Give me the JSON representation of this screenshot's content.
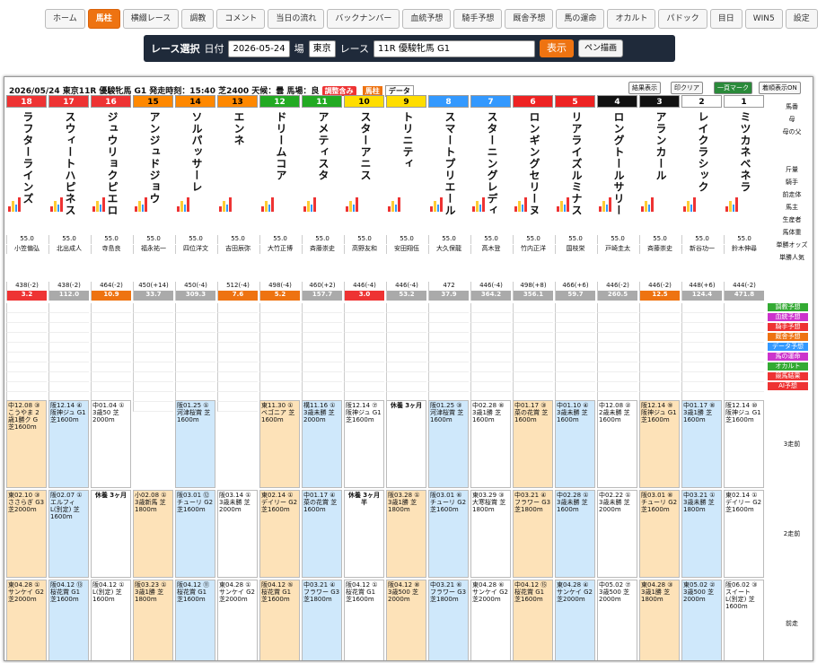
{
  "nav": [
    "ホーム",
    "馬柱",
    "横綴レース",
    "調教",
    "コメント",
    "当日の流れ",
    "バックナンバー",
    "血統予想",
    "騎手予想",
    "厩舎予想",
    "馬の運命",
    "オカルト",
    "パドック",
    "目日",
    "WIN5",
    "設定"
  ],
  "selector": {
    "title": "レース選択",
    "date_label": "日付",
    "date": "2026-05-24",
    "place_label": "場",
    "place": "東京",
    "race_label": "レース",
    "race": "11R 優駿牝馬 G1",
    "show": "表示",
    "pen": "ペン描画"
  },
  "raceinfo": "2026/05/24 東京11R 優駿牝馬 G1 発走時刻：15:40 芝2400 天候：曇 馬場：良",
  "tags": {
    "t1": "調整含み",
    "t2": "馬柱",
    "t3": "データ"
  },
  "header_buttons": [
    "結果表示",
    "印クリア",
    "一頁マーク",
    "着順表示ON"
  ],
  "row_labels": [
    "馬番",
    "母",
    "母の父",
    "",
    "",
    "斤量",
    "騎手",
    "前走体",
    "馬主",
    "生産者",
    "馬体重",
    "単勝オッズ",
    "単勝人気",
    "調教予想",
    "血統予想",
    "騎手予想",
    "厩舎予想",
    "データ予想",
    "馬の運命",
    "オカルト",
    "競馬結果",
    "AI予想",
    "3走前",
    "2走前",
    "前走"
  ],
  "horses": [
    {
      "num": "18",
      "name": "ラフターラインズ",
      "weight": "55.0",
      "jockey": "小笠偏弘",
      "trainer": "438(-2)",
      "odds": "3.2",
      "pop": "1"
    },
    {
      "num": "17",
      "name": "スウィートハピネス",
      "weight": "55.0",
      "jockey": "北出成人",
      "trainer": "438(-2)",
      "odds": "112.0",
      "pop": "14"
    },
    {
      "num": "16",
      "name": "ジュウリョクピエロ",
      "weight": "55.0",
      "jockey": "寺島良",
      "trainer": "464(-2)",
      "odds": "10.9",
      "pop": "6"
    },
    {
      "num": "15",
      "name": "アンジュドジョウ",
      "weight": "55.0",
      "jockey": "福永祐一",
      "trainer": "450(+14)",
      "odds": "33.7",
      "pop": "11"
    },
    {
      "num": "14",
      "name": "ソルパッサーレ",
      "weight": "55.0",
      "jockey": "四位洋文",
      "trainer": "450(-4)",
      "odds": "309.3",
      "pop": "18"
    },
    {
      "num": "13",
      "name": "エンネ",
      "weight": "55.0",
      "jockey": "吉田辰弥",
      "trainer": "512(-4)",
      "odds": "7.6",
      "pop": "4"
    },
    {
      "num": "12",
      "name": "ドリームコア",
      "weight": "55.0",
      "jockey": "大竹正博",
      "trainer": "498(-4)",
      "odds": "5.2",
      "pop": "3"
    },
    {
      "num": "11",
      "name": "アメティスタ",
      "weight": "55.0",
      "jockey": "斉藤崇史",
      "trainer": "460(+2)",
      "odds": "157.7",
      "pop": "16"
    },
    {
      "num": "10",
      "name": "スターアニス",
      "weight": "55.0",
      "jockey": "高野友和",
      "trainer": "446(-4)",
      "odds": "3.0",
      "pop": "2"
    },
    {
      "num": "9",
      "name": "トリニティ",
      "weight": "55.0",
      "jockey": "安田翔伍",
      "trainer": "446(-4)",
      "odds": "53.2",
      "pop": "13"
    },
    {
      "num": "8",
      "name": "スマートプリエール",
      "weight": "55.0",
      "jockey": "大久保龍",
      "trainer": "472",
      "odds": "37.9",
      "pop": "12"
    },
    {
      "num": "7",
      "name": "スターニングレディ",
      "weight": "55.0",
      "jockey": "高木登",
      "trainer": "446(-4)",
      "odds": "364.2",
      "pop": "17"
    },
    {
      "num": "6",
      "name": "ロンギングセリーヌ",
      "weight": "55.0",
      "jockey": "竹内正洋",
      "trainer": "498(+8)",
      "odds": "356.1",
      "pop": "15"
    },
    {
      "num": "5",
      "name": "リアライズルミナス",
      "weight": "55.0",
      "jockey": "国枝栄",
      "trainer": "466(+6)",
      "odds": "59.7",
      "pop": "10"
    },
    {
      "num": "4",
      "name": "ロングトールサリー",
      "weight": "55.0",
      "jockey": "戸崎圭太",
      "trainer": "446(-2)",
      "odds": "260.5",
      "pop": "8"
    },
    {
      "num": "3",
      "name": "アランカール",
      "weight": "55.0",
      "jockey": "斉藤崇史",
      "trainer": "446(-2)",
      "odds": "12.5",
      "pop": "7"
    },
    {
      "num": "2",
      "name": "レイクラシック",
      "weight": "55.0",
      "jockey": "新谷功一",
      "trainer": "448(+6)",
      "odds": "124.4",
      "pop": "9"
    },
    {
      "num": "1",
      "name": "ミツカネベネラ",
      "weight": "55.0",
      "jockey": "鈴木伸尋",
      "trainer": "444(-2)",
      "odds": "471.8",
      "pop": "5"
    }
  ],
  "past3": [
    "中12.08 ③ こうやま 2歳1勝ク G 芝1600m",
    "阪12.14 ④ 阪神ジュ G1 芝1600m",
    "中01.04 ① 3歳50 芝2000m",
    "",
    "阪01.25 ① 河津桜賞 芝1600m",
    "",
    "東11.30 ① ベゴニア 芝1600m",
    "構11.16 ① 3歳未勝 芝2000m",
    "阪12.14 ⑦ 阪神ジュ G1 芝1600m",
    "休養 3ヶ月",
    "阪01.25 ③ 河津桜賞 芝1600m",
    "中02.28 ⑧ 3歳1勝 芝1600m",
    "中01.17 ③ 菜の花賞 芝1600m",
    "中01.10 ④ 3歳未勝 芝1600m",
    "中12.08 ② 2歳未勝 芝1600m",
    "阪12.14 ⑨ 阪神ジュ G1 芝1600m",
    "中01.17 ⑧ 3歳1勝 芝1600m",
    "阪12.14 ⑩ 阪神ジュ G1 芝1600m"
  ],
  "past2": [
    "東02.10 ③ ささらぎ G3 芝2000m",
    "阪02.07 ① エルフィ L(別定) 芝1600m",
    "休養 3ヶ月",
    "小02.08 ① 3歳新馬 芝1800m",
    "阪03.01 ⑫ チューリ G2 芝1600m",
    "阪03.14 ① 3歳未勝 芝2000m",
    "東02.14 ① デイリー G2 芝1600m",
    "中01.17 ④ 菜の花賞 芝1600m",
    "休養 3ヶ月半",
    "阪03.28 ① 3歳1勝 芝1800m",
    "阪03.01 ⑥ チューリ G2 芝1600m",
    "東03.29 ③ 大寒桜賞 芝1800m",
    "中03.21 ④ フラワー G3 芝1800m",
    "中02.28 ① 3歳未勝 芝1600m",
    "中02.22 ① 3歳未勝 芝2000m",
    "阪03.01 ⑧ チューリ G2 芝1600m",
    "中03.21 ① 3歳未勝 芝1800m",
    "東02.14 ① デイリー G2 芝1600m"
  ],
  "past1": [
    "東04.28 ① サンケイ G2 芝2000m",
    "阪04.12 ⑬ 桜花賞 G1 芝1600m",
    "阪04.12 ① L(別定) 芝1600m",
    "阪03.23 ① 3歳1勝 芝1800m",
    "阪04.12 ⑪ 桜花賞 G1 芝1600m",
    "東04.28 ① サンケイ G2 芝2000m",
    "阪04.12 ⑤ 桜花賞 G1 芝1600m",
    "中03.21 ④ フラワー G3 芝1800m",
    "阪04.12 ① 桜花賞 G1 芝1600m",
    "阪04.12 ⑧ 3歳500 芝2000m",
    "中03.21 ⑥ フラワー G3 芝1800m",
    "東04.28 ⑥ サンケイ G2 芝2000m",
    "中04.12 ⑮ 桜花賞 G1 芝1600m",
    "東04.28 ④ サンケイ G2 芝2000m",
    "中05.02 ⑦ 3歳500 芝2000m",
    "東04.28 ③ 3歳1勝 芝1800m",
    "東05.02 ② 3歳500 芝2000m",
    "阪06.02 ③ スイート L(別定) 芝1600m"
  ],
  "colors": {
    "orange": "#ee7311",
    "nav_bg": "#1f2a3a"
  }
}
